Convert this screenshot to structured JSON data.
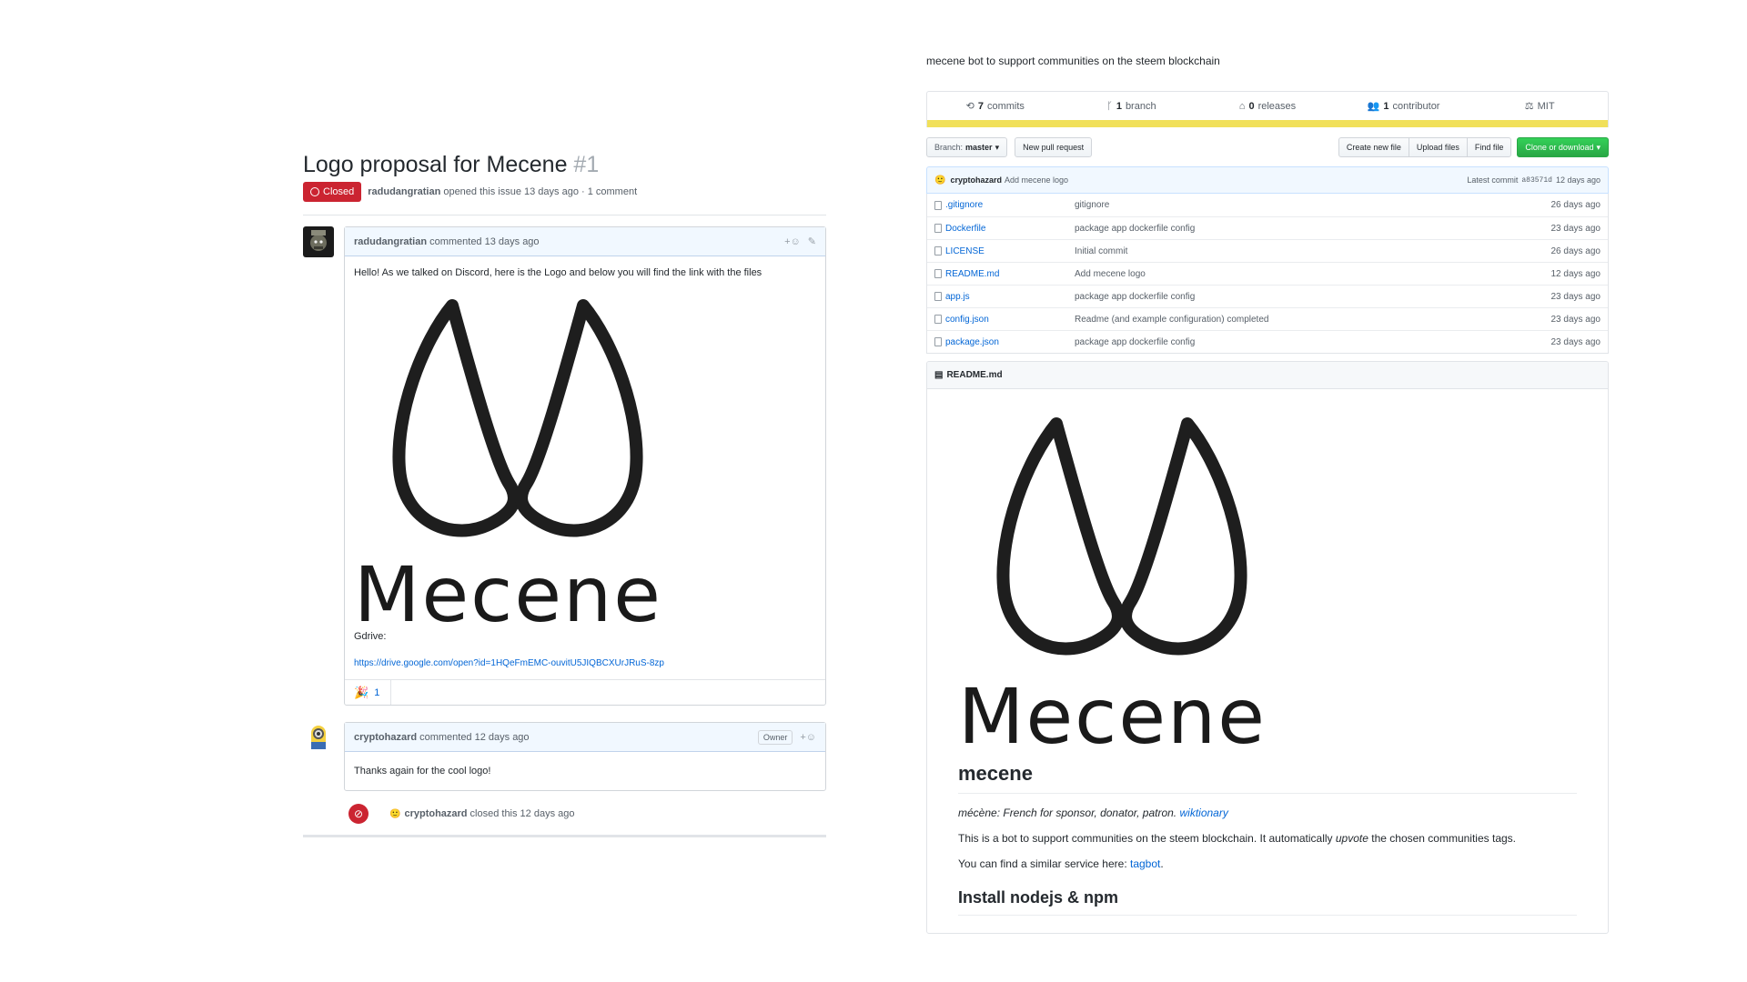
{
  "issue": {
    "title": "Logo proposal for Mecene",
    "number": "#1",
    "status_label": "Closed",
    "author": "radudangratian",
    "meta_text": "opened this issue 13 days ago · 1 comment",
    "comments": [
      {
        "author": "radudangratian",
        "meta": "commented 13 days ago",
        "intro": "Hello! As we talked on Discord, here is the Logo and below you will find the link with the files",
        "logo_word": "Mecene",
        "gdrive_label": "Gdrive:",
        "gdrive_link": "https://drive.google.com/open?id=1HQeFmEMC-ouvitU5JIQBCXUrJRuS-8zp",
        "reaction_count": "1"
      },
      {
        "author": "cryptohazard",
        "meta": "commented 12 days ago",
        "badge": "Owner",
        "body": "Thanks again for the cool logo!"
      }
    ],
    "closed_event": {
      "actor": "cryptohazard",
      "text": "closed this 12 days ago"
    }
  },
  "repo": {
    "description": "mecene bot to support communities on the steem blockchain",
    "numbers": {
      "commits_count": "7",
      "commits_label": "commits",
      "branch_count": "1",
      "branch_label": "branch",
      "releases_count": "0",
      "releases_label": "releases",
      "contributor_count": "1",
      "contributor_label": "contributor",
      "license": "MIT"
    },
    "language_color": "#f1e05a",
    "toolbar": {
      "branch_prefix": "Branch:",
      "branch_name": "master",
      "new_pr": "New pull request",
      "create_file": "Create new file",
      "upload_files": "Upload files",
      "find_file": "Find file",
      "clone": "Clone or download"
    },
    "latest_commit": {
      "author": "cryptohazard",
      "message": "Add mecene logo",
      "label": "Latest commit",
      "sha": "a83571d",
      "age": "12 days ago"
    },
    "files": [
      {
        "name": ".gitignore",
        "message": "gitignore",
        "age": "26 days ago"
      },
      {
        "name": "Dockerfile",
        "message": "package app dockerfile config",
        "age": "23 days ago"
      },
      {
        "name": "LICENSE",
        "message": "Initial commit",
        "age": "26 days ago"
      },
      {
        "name": "README.md",
        "message": "Add mecene logo",
        "age": "12 days ago"
      },
      {
        "name": "app.js",
        "message": "package app dockerfile config",
        "age": "23 days ago"
      },
      {
        "name": "config.json",
        "message": "Readme (and example configuration) completed",
        "age": "23 days ago"
      },
      {
        "name": "package.json",
        "message": "package app dockerfile config",
        "age": "23 days ago"
      }
    ],
    "readme": {
      "header": "README.md",
      "logo_word": "Mecene",
      "h1": "mecene",
      "def_text": "mécène: French for sponsor, donator, patron.",
      "def_link": "wiktionary",
      "p1_before": "This is a bot to support communities on the steem blockchain. It automatically",
      "p1_em": "upvote",
      "p1_after": "the chosen communities tags.",
      "p2_text": "You can find a similar service here:",
      "p2_link": "tagbot",
      "p2_end": ".",
      "h2": "Install nodejs & npm"
    }
  }
}
